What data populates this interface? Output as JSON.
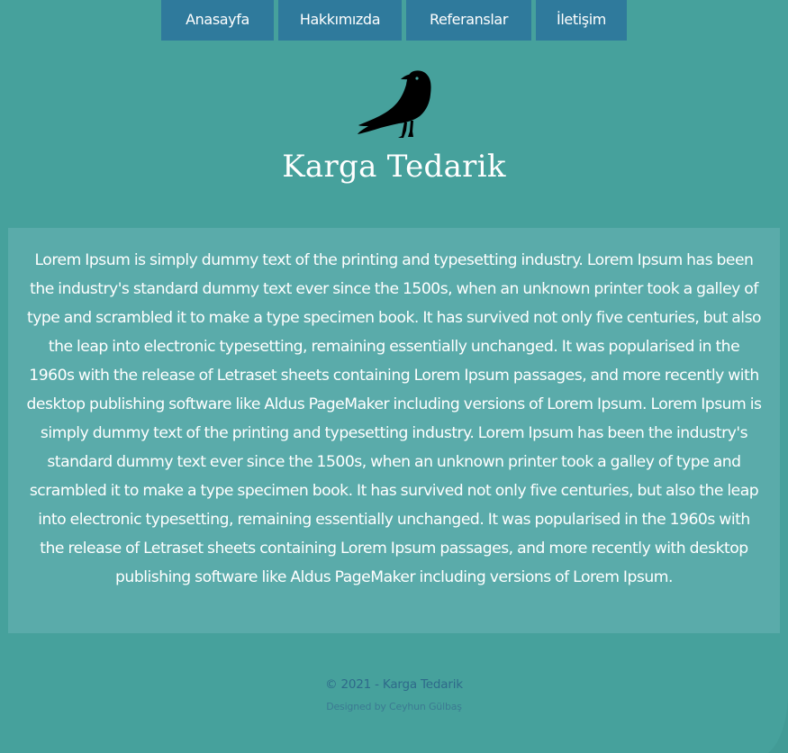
{
  "nav": {
    "items": [
      {
        "label": "Anasayfa"
      },
      {
        "label": "Hakkımızda"
      },
      {
        "label": "Referanslar"
      },
      {
        "label": "İletişim"
      }
    ]
  },
  "header": {
    "logo_icon": "crow-icon",
    "brand": "Karga Tedarik"
  },
  "main": {
    "paragraph": "Lorem Ipsum is simply dummy text of the printing and typesetting industry. Lorem Ipsum has been the industry's standard dummy text ever since the 1500s, when an unknown printer took a galley of type and scrambled it to make a type specimen book. It has survived not only five centuries, but also the leap into electronic typesetting, remaining essentially unchanged. It was popularised in the 1960s with the release of Letraset sheets containing Lorem Ipsum passages, and more recently with desktop publishing software like Aldus PageMaker including versions of Lorem Ipsum. Lorem Ipsum is simply dummy text of the printing and typesetting industry. Lorem Ipsum has been the industry's standard dummy text ever since the 1500s, when an unknown printer took a galley of type and scrambled it to make a type specimen book. It has survived not only five centuries, but also the leap into electronic typesetting, remaining essentially unchanged. It was popularised in the 1960s with the release of Letraset sheets containing Lorem Ipsum passages, and more recently with desktop publishing software like Aldus PageMaker including versions of Lorem Ipsum."
  },
  "footer": {
    "copyright": "© 2021 - Karga Tedarik",
    "designer": "Designed by Ceyhun Gülbaş"
  },
  "colors": {
    "background": "#46a19c",
    "nav_button": "#2f7a9c",
    "content_panel": "#5aabaa",
    "text": "#ffffff",
    "footer_text": "#2e6a8a"
  }
}
